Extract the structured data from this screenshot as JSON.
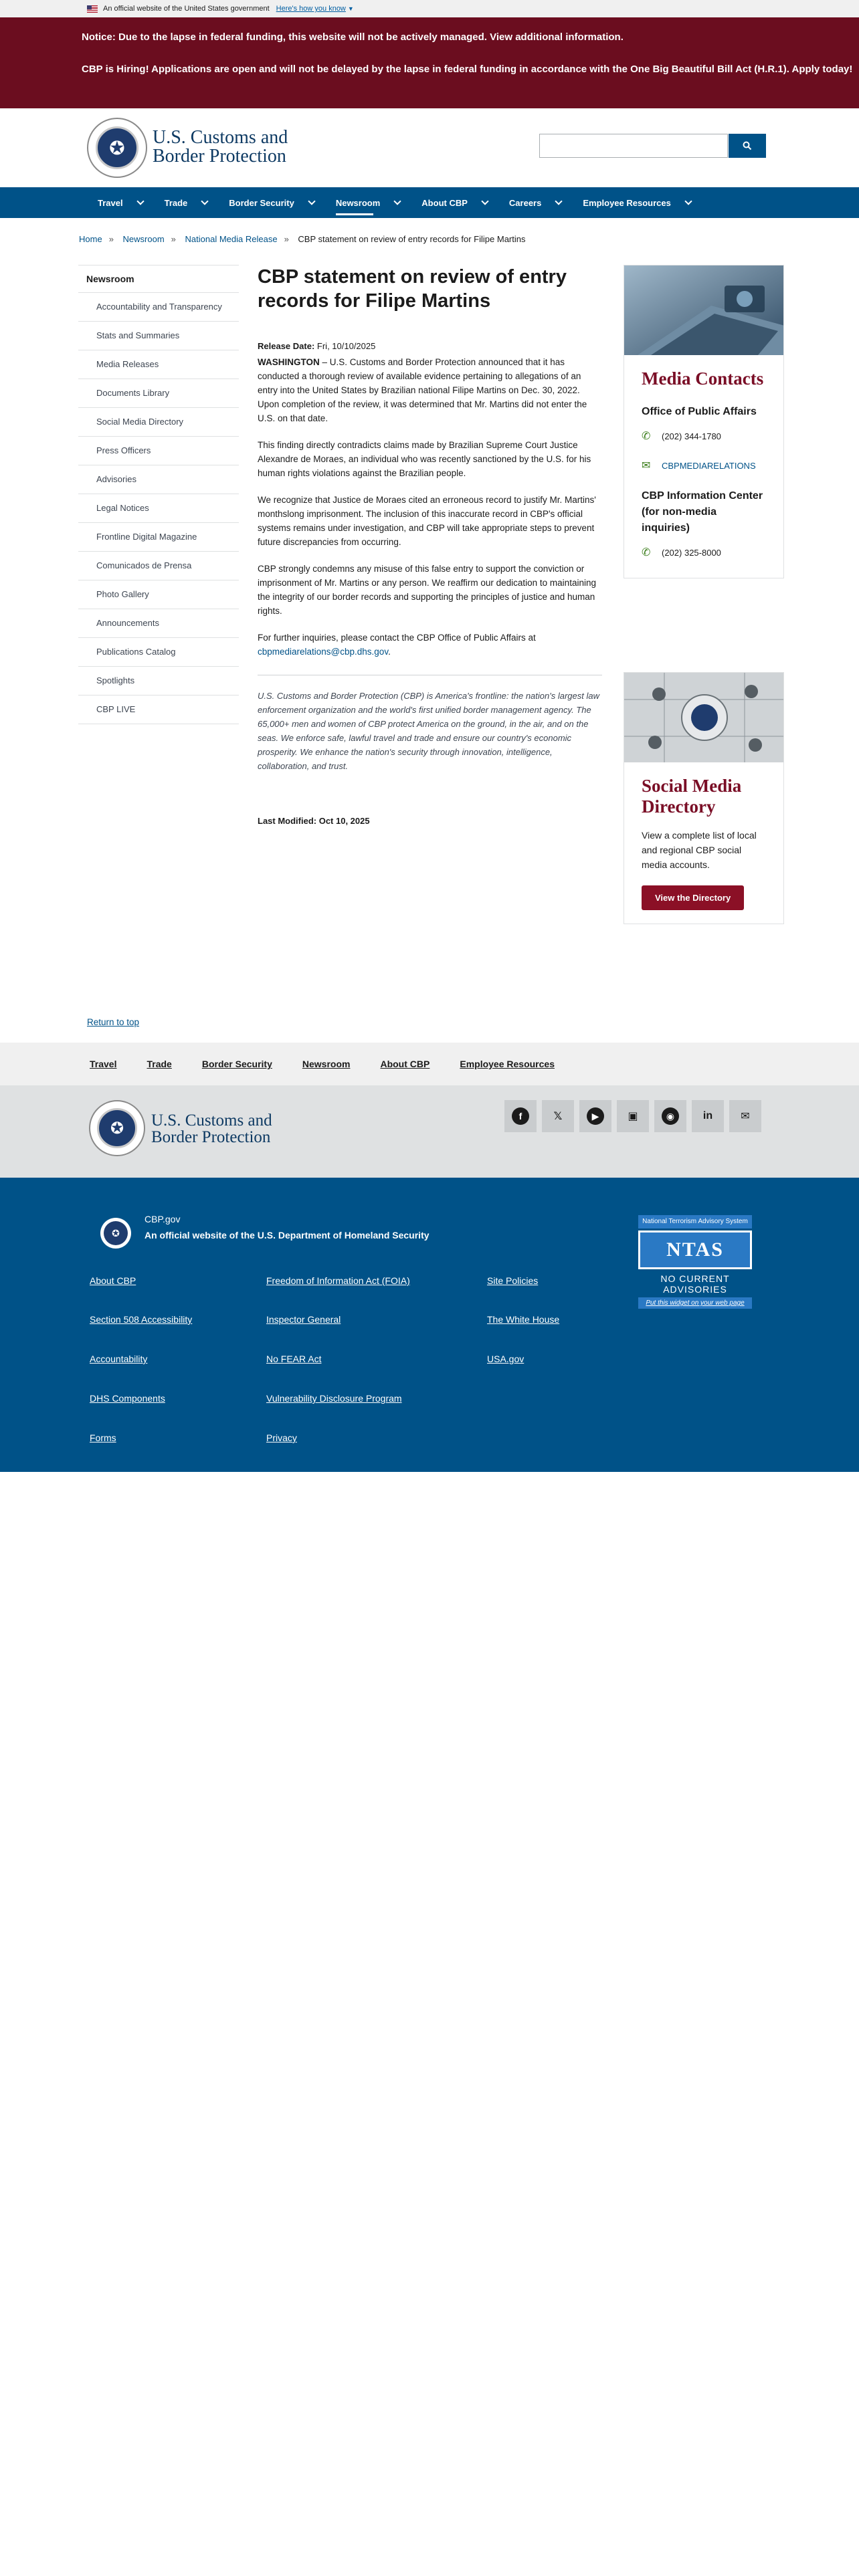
{
  "gov_banner": {
    "text": "An official website of the United States government",
    "link": "Here's how you know"
  },
  "alert": {
    "notice_text": "Notice: Due to the lapse in federal funding, this website will not be actively managed.",
    "notice_link": "View additional information.",
    "hiring_text": "CBP is Hiring! Applications are open and will not be delayed by the lapse in federal funding in accordance with the One Big Beautiful Bill Act (H.R.1). Apply today!"
  },
  "header": {
    "logo_line1": "U.S. Customs and",
    "logo_line2": "Border Protection",
    "search_placeholder": ""
  },
  "nav": [
    "Travel",
    "Trade",
    "Border Security",
    "Newsroom",
    "About CBP",
    "Careers",
    "Employee Resources"
  ],
  "breadcrumb": [
    "Home",
    "Newsroom",
    "National Media Release",
    "CBP statement on review of entry records for Filipe Martins"
  ],
  "sidenav": {
    "title": "Newsroom",
    "items": [
      "Accountability and Transparency",
      "Stats and Summaries",
      "Media Releases",
      "Documents Library",
      "Social Media Directory",
      "Press Officers",
      "Advisories",
      "Legal Notices",
      "Frontline Digital Magazine",
      "Comunicados de Prensa",
      "Photo Gallery",
      "Announcements",
      "Publications Catalog",
      "Spotlights",
      "CBP LIVE"
    ]
  },
  "article": {
    "title": "CBP statement on review of entry records for Filipe Martins",
    "release_label": "Release Date:",
    "release_date": "Fri, 10/10/2025",
    "dateline": "WASHINGTON",
    "p1": " – U.S. Customs and Border Protection announced that it has conducted a thorough review of available evidence pertaining to allegations of an entry into the United States by Brazilian national Filipe Martins on Dec. 30, 2022. Upon completion of the review, it was determined that Mr. Martins did not enter the U.S. on that date.",
    "p2": "This finding directly contradicts claims made by Brazilian Supreme Court Justice Alexandre de Moraes, an individual who was recently sanctioned by the U.S. for his human rights violations against the Brazilian people.",
    "p3": "We recognize that Justice de Moraes cited an erroneous record to justify Mr. Martins' monthslong imprisonment. The inclusion of this inaccurate record in CBP's official systems remains under investigation, and CBP will take appropriate steps to prevent future discrepancies from occurring.",
    "p4": "CBP strongly condemns any misuse of this false entry to support the conviction or imprisonment of Mr. Martins or any person. We reaffirm our dedication to maintaining the integrity of our border records and supporting the principles of justice and human rights.",
    "p5_text": "For further inquiries, please contact the CBP Office of Public Affairs at ",
    "p5_email": "cbpmediarelations@cbp.dhs.gov",
    "p5_end": ".",
    "about": "U.S. Customs and Border Protection (CBP) is America's frontline: the nation's largest law enforcement organization and the world's first unified border management agency. The 65,000+ men and women of CBP protect America on the ground, in the air, and on the seas. We enforce safe, lawful travel and trade and ensure our country's economic prosperity. We enhance the nation's security through innovation, intelligence, collaboration, and trust.",
    "modified": "Last Modified: Oct 10, 2025"
  },
  "media_card": {
    "title": "Media Contacts",
    "office": "Office of Public Affairs",
    "phone1": "(202) 344-1780",
    "email_label": "CBPMEDIARELATIONS",
    "info_title": "CBP Information Center (for non-media inquiries)",
    "phone2": "(202) 325-8000"
  },
  "social_card": {
    "title": "Social Media Directory",
    "text": "View a complete list of local and regional CBP social media accounts.",
    "button": "View the Directory"
  },
  "return_top": "Return to top",
  "footer_nav": [
    "Travel",
    "Trade",
    "Border Security",
    "Newsroom",
    "About CBP",
    "Employee Resources"
  ],
  "footer_logo": {
    "line1": "U.S. Customs and",
    "line2": "Border Protection"
  },
  "social_icons": [
    "facebook-icon",
    "x-icon",
    "youtube-icon",
    "flickr-icon",
    "instagram-icon",
    "linkedin-icon",
    "email-icon"
  ],
  "bluefoot": {
    "site": "CBP.gov",
    "official_prefix": "An official website of the ",
    "official_link": "U.S. Department of Homeland Security",
    "col1": [
      "About CBP",
      "Section 508 Accessibility",
      "Accountability",
      "DHS Components",
      "Forms"
    ],
    "col2": [
      "Freedom of Information Act (FOIA)",
      "Inspector General",
      "No FEAR Act",
      "Vulnerability Disclosure Program",
      "Privacy"
    ],
    "col3": [
      "Site Policies",
      "The White House",
      "USA.gov"
    ]
  },
  "ntas": {
    "top": "National Terrorism Advisory System",
    "logo": "NTAS",
    "status": "NO CURRENT ADVISORIES",
    "widget": "Put this widget on your web page"
  },
  "colors": {
    "nav_blue": "#005288",
    "alert_maroon": "#6b0d1f",
    "card_maroon": "#7a0e26"
  }
}
